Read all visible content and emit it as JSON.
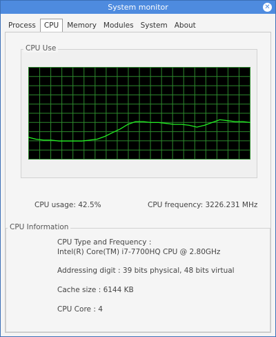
{
  "window": {
    "title": "System monitor",
    "close_glyph": "✕"
  },
  "tabs": [
    {
      "label": "Process",
      "active": false
    },
    {
      "label": "CPU",
      "active": true
    },
    {
      "label": "Memory",
      "active": false
    },
    {
      "label": "Modules",
      "active": false
    },
    {
      "label": "System",
      "active": false
    },
    {
      "label": "About",
      "active": false
    }
  ],
  "cpu_use": {
    "title": "CPU Use",
    "graph": {
      "background": "#000000",
      "grid_color": "#2d8a2d",
      "line_color": "#22ee22",
      "y_range": [
        0,
        100
      ],
      "values": [
        24,
        22,
        21,
        21,
        20,
        20,
        20,
        20,
        21,
        22,
        25,
        29,
        33,
        38,
        41,
        41,
        40,
        40,
        39,
        38,
        38,
        37,
        35,
        37,
        40,
        43,
        42,
        41,
        41,
        40
      ]
    }
  },
  "stats": {
    "usage": "CPU usage: 42.5%",
    "frequency": "CPU frequency: 3226.231 MHz"
  },
  "cpu_info": {
    "title": "CPU Information",
    "type_label": "CPU Type and Frequency :",
    "type_value": "Intel(R) Core(TM) i7-7700HQ CPU @ 2.80GHz",
    "addressing": "Addressing digit : 39 bits physical, 48 bits virtual",
    "cache": "Cache size : 6144 KB",
    "cores": "CPU Core : 4"
  }
}
